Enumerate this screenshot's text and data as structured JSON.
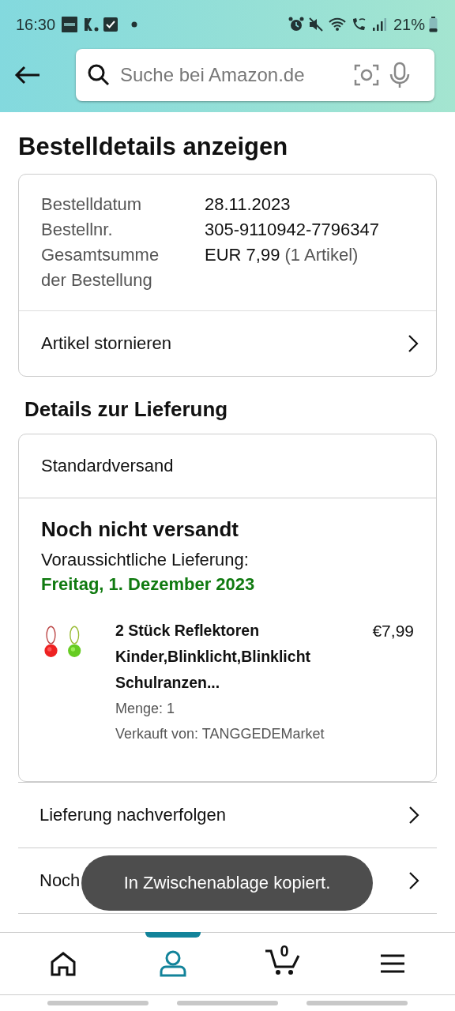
{
  "status_bar": {
    "time": "16:30",
    "battery": "21%"
  },
  "search": {
    "placeholder": "Suche bei Amazon.de"
  },
  "page_title": "Bestelldetails anzeigen",
  "order_summary": {
    "fields": [
      {
        "label": "Bestelldatum",
        "value": "28.11.2023"
      },
      {
        "label": "Bestellnr.",
        "value": "305-9110942-7796347"
      },
      {
        "label": "Gesamtsumme der Bestellung",
        "value": "EUR 7,99",
        "note": "(1 Artikel)"
      }
    ],
    "action": "Artikel stornieren"
  },
  "delivery": {
    "title": "Details zur Lieferung",
    "shipping_method": "Standardversand",
    "status": "Noch nicht versandt",
    "expected_label": "Voraussichtliche Lieferung:",
    "expected_date": "Freitag, 1. Dezember 2023",
    "item": {
      "title": "2 Stück Reflektoren Kinder,Blinklicht,Blinklicht Schulranzen...",
      "price": "€7,99",
      "quantity": "Menge: 1",
      "seller": "Verkauft von: TANGGEDEMarket"
    }
  },
  "actions": [
    "Lieferung nachverfolgen",
    "Noch"
  ],
  "toast": "In Zwischenablage kopiert.",
  "bottom_nav": [
    {
      "kind": "home",
      "selected": false
    },
    {
      "kind": "account",
      "selected": true
    },
    {
      "kind": "cart",
      "badge": "0",
      "selected": false
    },
    {
      "kind": "menu",
      "selected": false
    }
  ]
}
